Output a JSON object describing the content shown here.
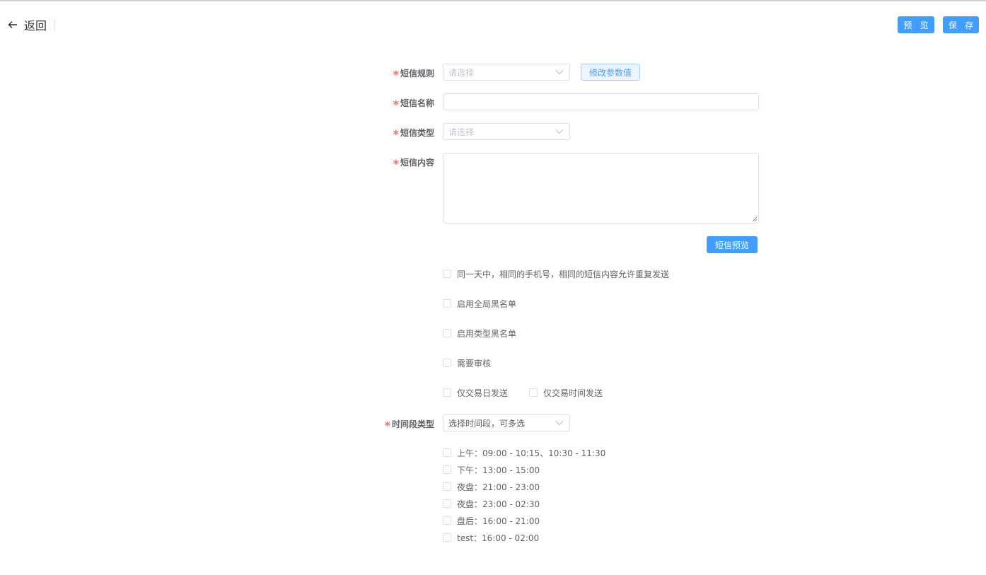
{
  "header": {
    "back_label": "返回",
    "preview_label": "预 览",
    "save_label": "保 存"
  },
  "form": {
    "sms_rule": {
      "label": "短信规则",
      "placeholder": "请选择",
      "param_button": "修改参数值"
    },
    "sms_name": {
      "label": "短信名称",
      "value": ""
    },
    "sms_type": {
      "label": "短信类型",
      "placeholder": "请选择"
    },
    "sms_content": {
      "label": "短信内容",
      "value": ""
    },
    "sms_preview_button": "短信预览",
    "options": {
      "allow_duplicate": "同一天中，相同的手机号，相同的短信内容允许重复发送",
      "global_blacklist": "启用全局黑名单",
      "type_blacklist": "启用类型黑名单",
      "need_review": "需要审核",
      "trading_day_only": "仅交易日发送",
      "trading_time_only": "仅交易时间发送"
    },
    "period_type": {
      "label": "时间段类型",
      "value": "选择时间段，可多选"
    },
    "periods": [
      "上午：09:00 - 10:15、10:30 - 11:30",
      "下午：13:00 - 15:00",
      "夜盘：21:00 - 23:00",
      "夜盘：23:00 - 02:30",
      "盘后：16:00 - 21:00",
      "test：16:00 - 02:00"
    ]
  },
  "colors": {
    "primary": "#409eff",
    "required": "#f56c6c",
    "border": "#dcdfe6"
  }
}
